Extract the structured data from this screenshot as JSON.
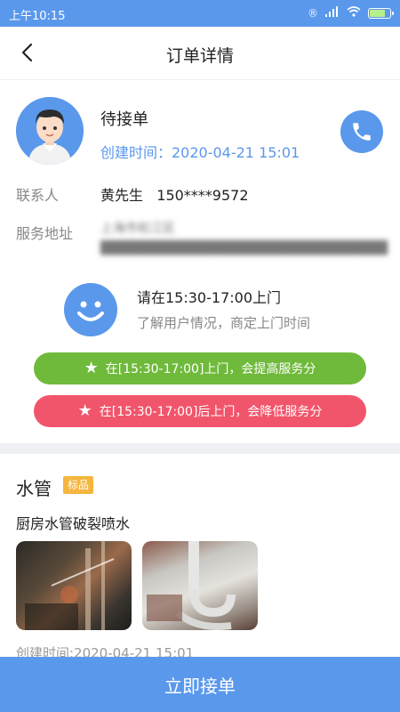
{
  "status_bar": {
    "time": "上午10:15"
  },
  "nav": {
    "title": "订单详情"
  },
  "order": {
    "status": "待接单",
    "created": "创建时间：2020-04-21 15:01"
  },
  "contact": {
    "label": "联系人",
    "value": "黄先生   150****9572"
  },
  "address": {
    "label": "服务地址",
    "value": "上海市松江区██████████████████████████████"
  },
  "reminder": {
    "title": "请在15:30-17:00上门",
    "subtitle": "了解用户情况，商定上门时间"
  },
  "tips": {
    "on_time": "在[15:30-17:00]上门，会提高服务分",
    "late": "在[15:30-17:00]后上门，会降低服务分"
  },
  "service": {
    "name": "水管",
    "tag": "标品",
    "description": "厨房水管破裂喷水",
    "created": "创建时间:2020-04-21 15:01"
  },
  "actions": {
    "accept": "立即接单"
  }
}
